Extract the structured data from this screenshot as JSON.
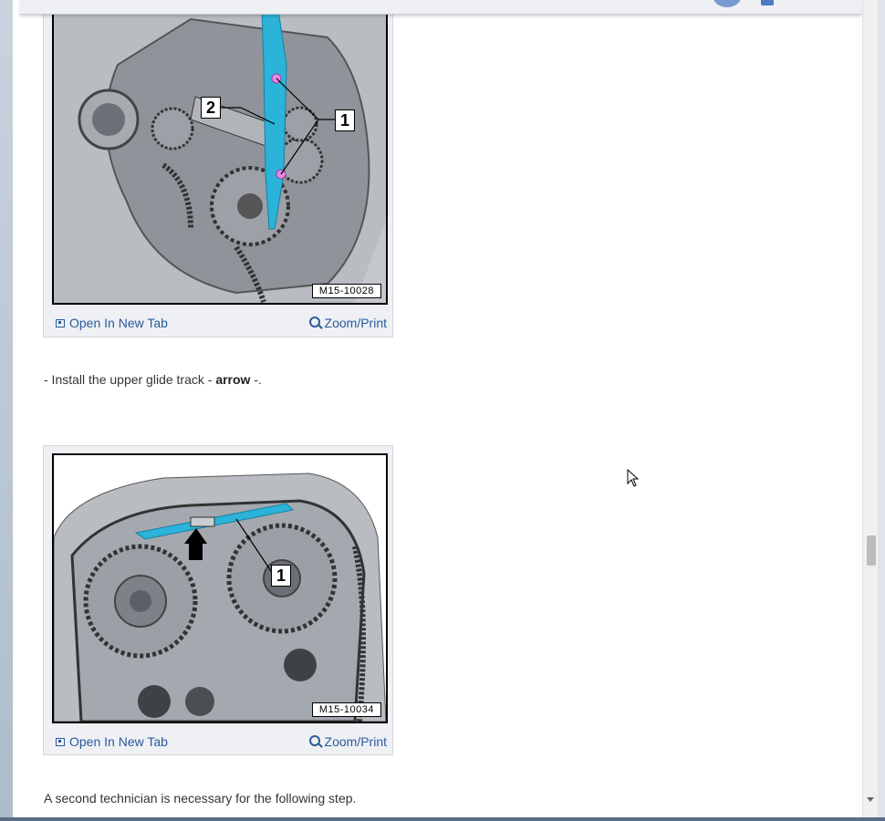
{
  "figures": [
    {
      "code": "M15-10028",
      "callouts": [
        "2",
        "1"
      ],
      "open_label": "Open In New Tab",
      "zoom_label": "Zoom/Print"
    },
    {
      "code": "M15-10034",
      "callouts": [
        "1"
      ],
      "open_label": "Open In New Tab",
      "zoom_label": "Zoom/Print"
    }
  ],
  "step": {
    "prefix": "-  Install the upper glide track - ",
    "bold": "arrow",
    "suffix": " -."
  },
  "note": "A second technician is necessary for the following step.",
  "colors": {
    "link": "#2a5a9c",
    "highlight": "#2bb3d9",
    "text": "#333333"
  },
  "icons": [
    "open-new-tab-icon",
    "zoom-icon",
    "mouse-cursor-icon"
  ]
}
